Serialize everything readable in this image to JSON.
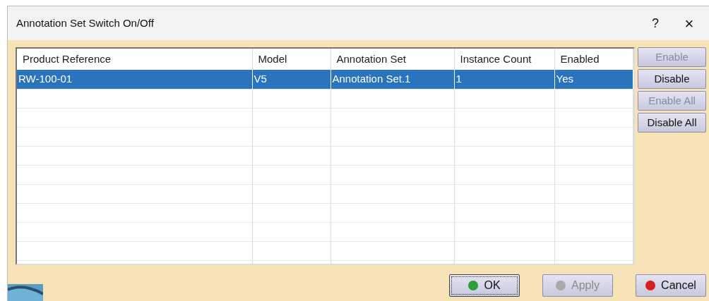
{
  "window": {
    "title": "Annotation Set Switch On/Off",
    "help": "?",
    "close": "×"
  },
  "table": {
    "columns": [
      "Product Reference",
      "Model",
      "Annotation Set",
      "Instance Count",
      "Enabled"
    ],
    "rows": [
      {
        "cells": [
          "RW-100-01",
          "V5",
          "Annotation Set.1",
          "1",
          "Yes"
        ],
        "selected": true
      }
    ]
  },
  "side_buttons": [
    {
      "label": "Enable",
      "disabled": true
    },
    {
      "label": "Disable",
      "disabled": false
    },
    {
      "label": "Enable All",
      "disabled": true
    },
    {
      "label": "Disable All",
      "disabled": false
    }
  ],
  "buttons": [
    {
      "label": "OK",
      "disabled": false,
      "focused": true,
      "color": "#2e9e3a"
    },
    {
      "label": "Apply",
      "disabled": true,
      "focused": false,
      "color": "#a9a9a9"
    },
    {
      "label": "Cancel",
      "disabled": false,
      "focused": false,
      "color": "#d42020"
    }
  ]
}
